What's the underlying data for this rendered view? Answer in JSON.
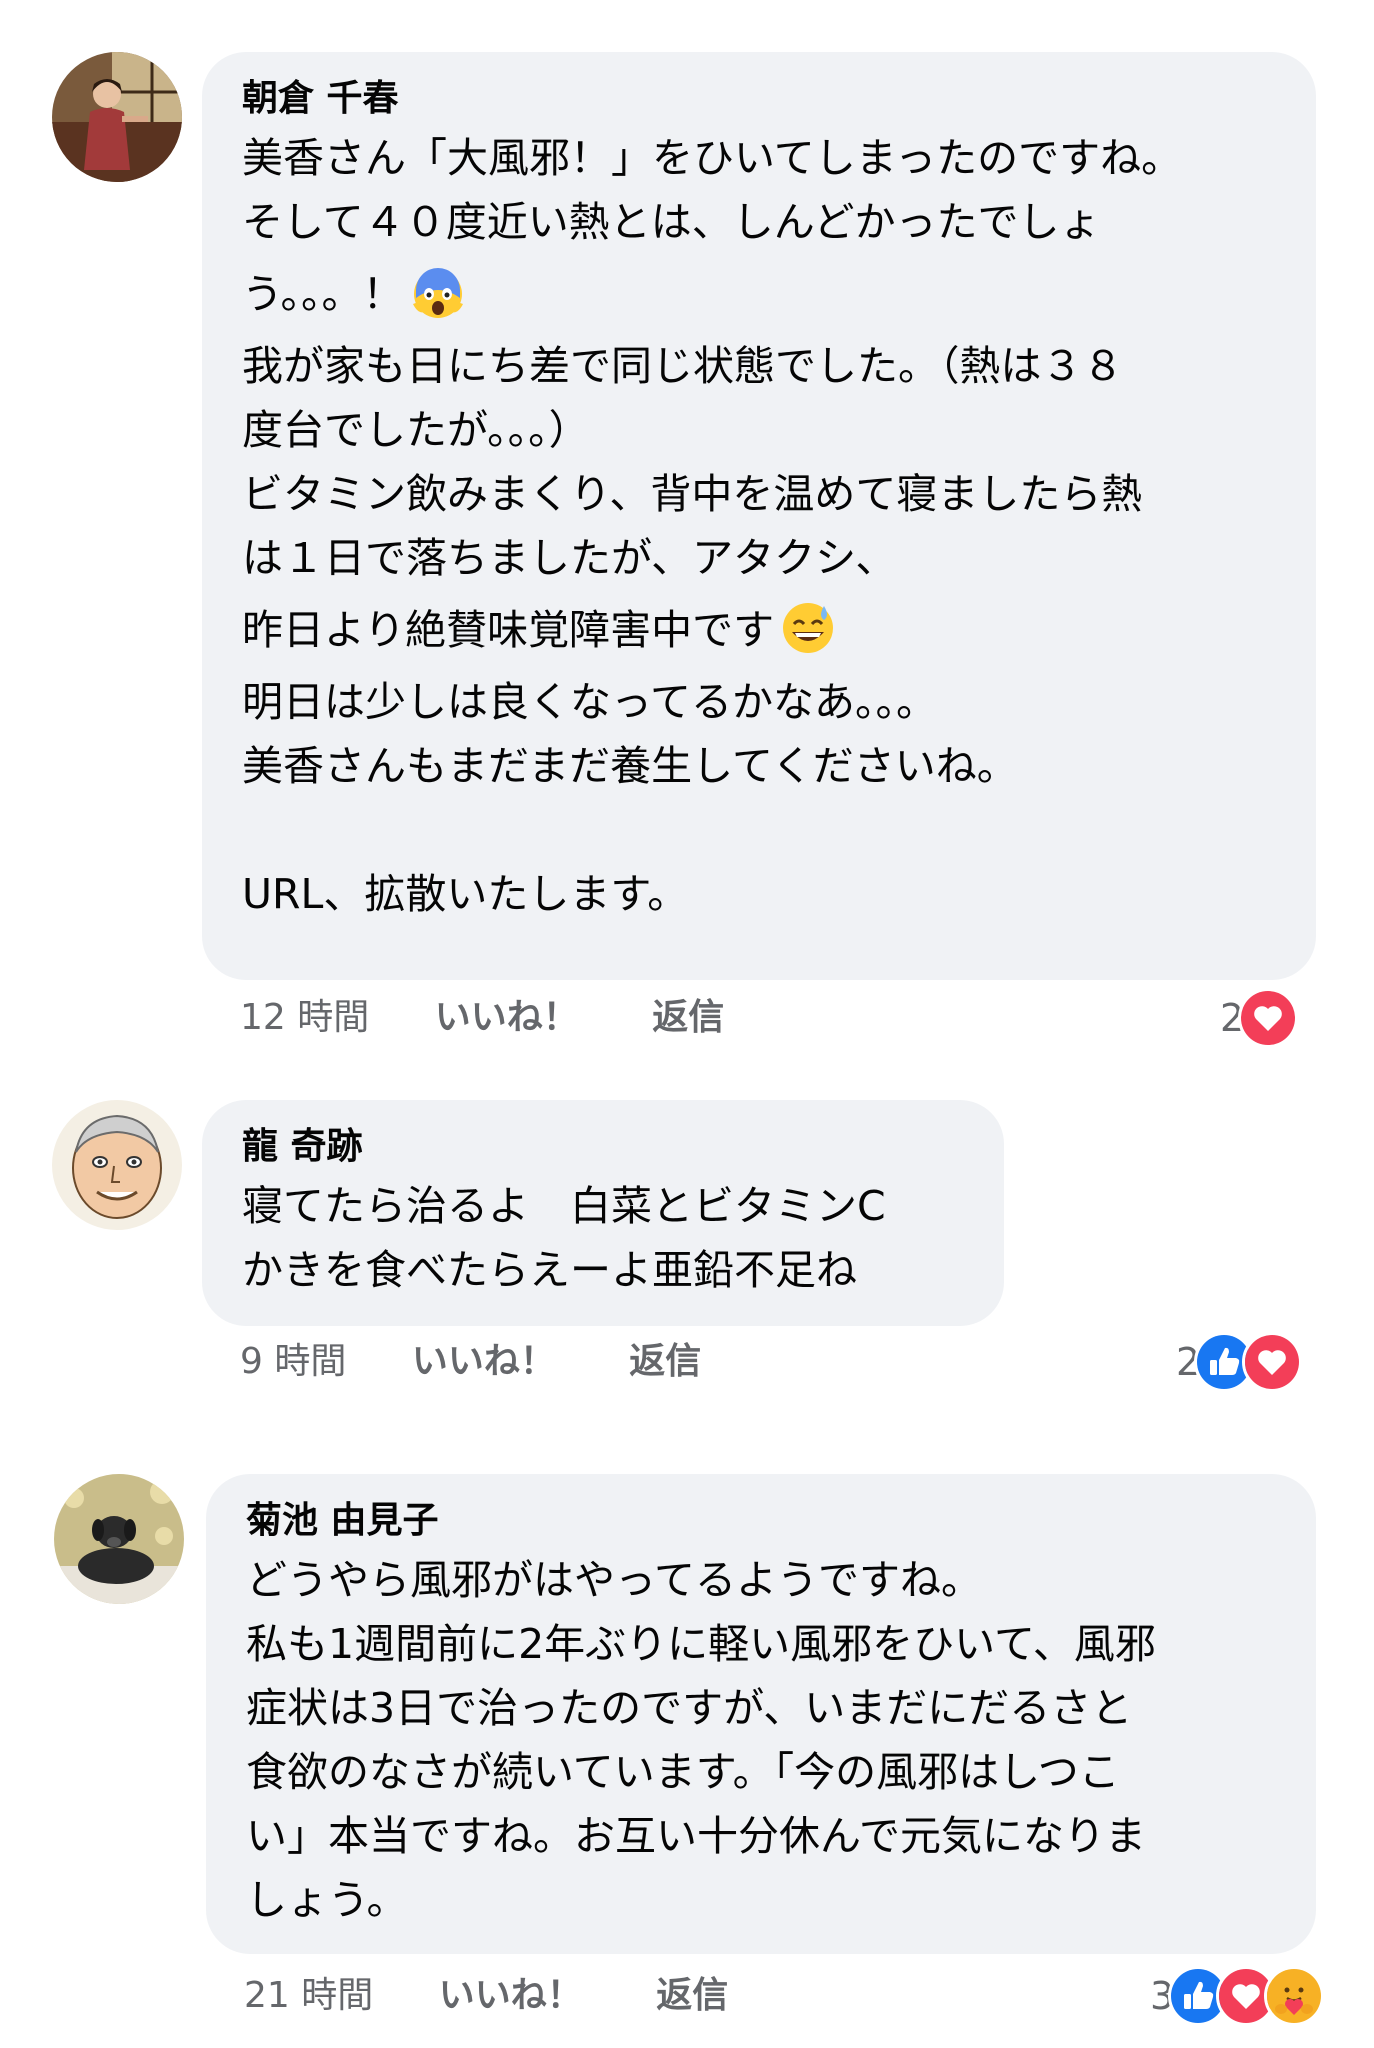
{
  "comments": [
    {
      "author": "朝倉 千春",
      "lines": {
        "l1": "美香さん「大風邪！」をひいてしまったのですね。",
        "l2": "そして４０度近い熱とは、しんどかったでしょ",
        "l3": "う。。。！",
        "l4": "我が家も日にち差で同じ状態でした。（熱は３８",
        "l5": "度台でしたが。。。）",
        "l6": "ビタミン飲みまくり、背中を温めて寝ましたら熱",
        "l7": "は１日で落ちましたが、アタクシ、",
        "l8": "昨日より絶賛味覚障害中です",
        "l9": "明日は少しは良くなってるかなあ。。。",
        "l10": "美香さんもまだまだ養生してくださいね。",
        "l11": "URL、拡散いたします。"
      },
      "time": "12 時間",
      "like_label": "いいね！",
      "reply_label": "返信",
      "reaction_count": "2",
      "reactions": [
        "love"
      ]
    },
    {
      "author": "龍 奇跡",
      "lines": {
        "l1": "寝てたら治るよ　白菜とビタミンC",
        "l2": "かきを食べたらえーよ亜鉛不足ね"
      },
      "time": "9 時間",
      "like_label": "いいね！",
      "reply_label": "返信",
      "reaction_count": "2",
      "reactions": [
        "like",
        "love"
      ]
    },
    {
      "author": "菊池 由見子",
      "lines": {
        "l1": "どうやら風邪がはやってるようですね。",
        "l2": "私も1週間前に2年ぶりに軽い風邪をひいて、風邪",
        "l3": "症状は3日で治ったのですが、いまだにだるさと",
        "l4": "食欲のなさが続いています。「今の風邪はしつこ",
        "l5": "い」本当ですね。お互い十分休んで元気になりま",
        "l6": "しょう。"
      },
      "time": "21 時間",
      "like_label": "いいね！",
      "reply_label": "返信",
      "reaction_count": "3",
      "reactions": [
        "like",
        "love",
        "care"
      ]
    }
  ],
  "icons": {
    "emoji_1": "face-screaming-in-fear-emoji",
    "emoji_2": "grinning-face-with-sweat-emoji",
    "reaction_like": "thumbs-up-like-icon",
    "reaction_love": "heart-love-icon",
    "reaction_care": "care-hug-icon"
  },
  "colors": {
    "bubble_bg": "#f0f2f5",
    "meta_text": "#65676b",
    "like_blue": "#1877f2",
    "love_red": "#f33e58",
    "care_yellow": "#f7b125"
  }
}
